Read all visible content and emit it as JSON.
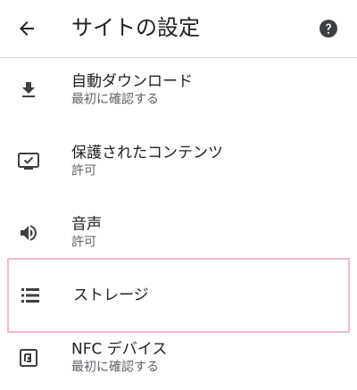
{
  "header": {
    "title": "サイトの設定",
    "back_icon": "arrow-back-icon",
    "help_icon": "help-circle-icon"
  },
  "items": [
    {
      "label": "自動ダウンロード",
      "sub": "最初に確認する",
      "icon": "download-icon"
    },
    {
      "label": "保護されたコンテンツ",
      "sub": "許可",
      "icon": "protected-content-icon"
    },
    {
      "label": "音声",
      "sub": "許可",
      "icon": "volume-icon"
    },
    {
      "label": "ストレージ",
      "sub": "",
      "icon": "storage-icon"
    },
    {
      "label": "NFC デバイス",
      "sub": "最初に確認する",
      "icon": "nfc-icon"
    }
  ],
  "colors": {
    "icon": "#3c4043",
    "highlight_border": "#f4b8d2"
  }
}
